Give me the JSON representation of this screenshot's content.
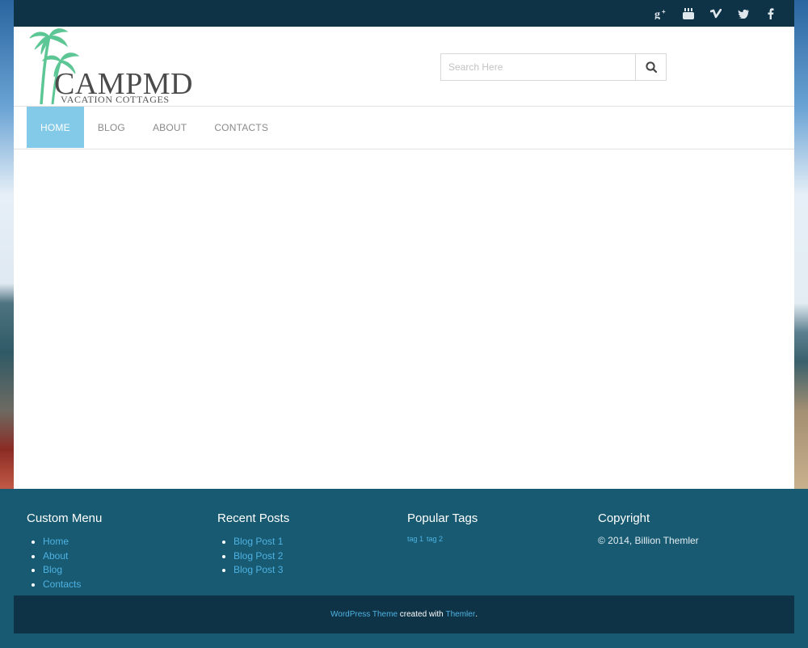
{
  "social": {
    "icons": [
      "google-plus-icon",
      "youtube-icon",
      "vimeo-icon",
      "twitter-icon",
      "facebook-icon"
    ]
  },
  "logo": {
    "name": "CAMPMD",
    "tagline": "VACATION COTTAGES",
    "palm_color": "#5cc694"
  },
  "search": {
    "placeholder": "Search Here"
  },
  "nav": {
    "items": [
      {
        "label": "HOME",
        "active": true
      },
      {
        "label": "BLOG",
        "active": false
      },
      {
        "label": "ABOUT",
        "active": false
      },
      {
        "label": "CONTACTS",
        "active": false
      }
    ]
  },
  "footer": {
    "custom_menu": {
      "title": "Custom Menu",
      "items": [
        "Home",
        "About",
        "Blog",
        "Contacts"
      ]
    },
    "recent_posts": {
      "title": "Recent Posts",
      "items": [
        "Blog Post 1",
        "Blog Post 2",
        "Blog Post 3"
      ]
    },
    "popular_tags": {
      "title": "Popular Tags",
      "tags": [
        "tag 1",
        "tag 2"
      ]
    },
    "copyright": {
      "title": "Copyright",
      "text": "© 2014, Billion Themler"
    }
  },
  "bottom": {
    "link1": "WordPress Theme",
    "middle": " created with ",
    "link2": "Themler",
    "end": "."
  },
  "colors": {
    "topbar": "#0e3346",
    "nav_active": "#83c9e8",
    "footer": "#175a72",
    "link": "#4fb2e2"
  }
}
